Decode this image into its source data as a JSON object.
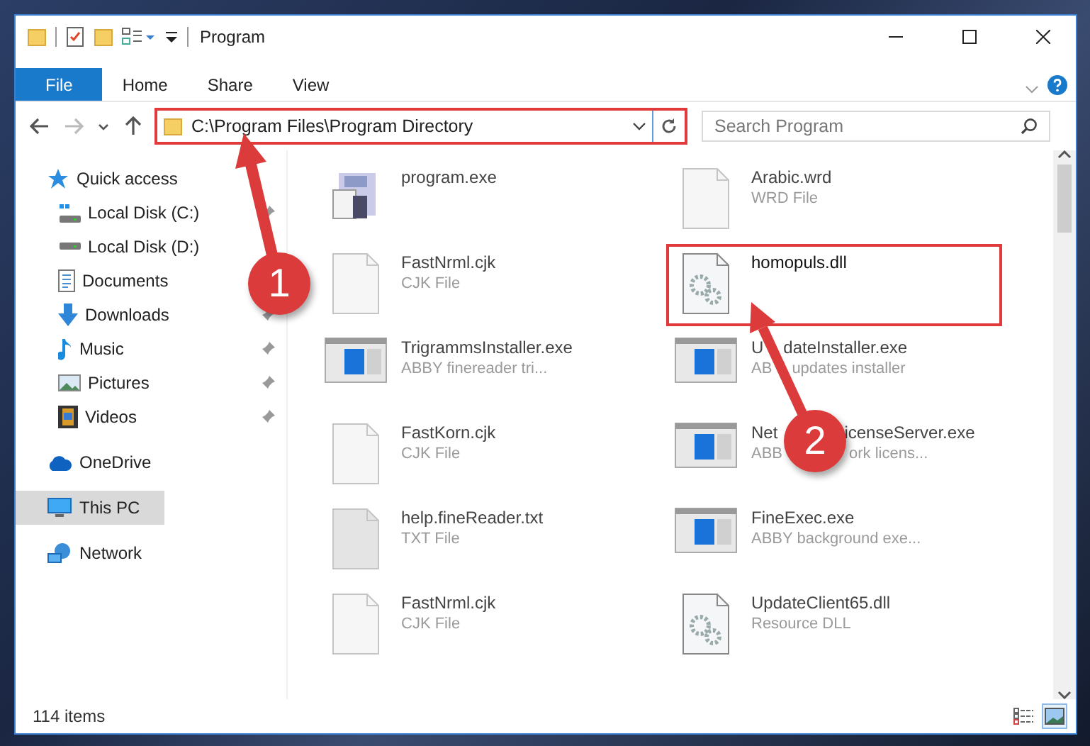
{
  "window": {
    "title": "Program"
  },
  "ribbon": {
    "tabs": [
      {
        "label": "File",
        "selected": true
      },
      {
        "label": "Home",
        "selected": false
      },
      {
        "label": "Share",
        "selected": false
      },
      {
        "label": "View",
        "selected": false
      }
    ]
  },
  "navigation": [
    {
      "kind": "back",
      "disabled": false
    },
    {
      "kind": "forward",
      "disabled": true
    },
    {
      "kind": "recent",
      "disabled": false
    },
    {
      "kind": "up",
      "disabled": false
    }
  ],
  "address_bar": {
    "path": "C:\\Program Files\\Program Directory",
    "highlighted": true
  },
  "search": {
    "placeholder": "Search Program"
  },
  "sidebar": {
    "items": [
      {
        "label": "Quick access",
        "kind": "star",
        "selected": false,
        "children": [
          {
            "label": "Local Disk (C:)",
            "kind": "system-drive",
            "pinned": true,
            "selected": false
          },
          {
            "label": "Local Disk (D:)",
            "kind": "drive",
            "pinned": false,
            "selected": false
          },
          {
            "label": "Documents",
            "kind": "document",
            "pinned": false,
            "selected": false
          },
          {
            "label": "Downloads",
            "kind": "download",
            "pinned": true,
            "selected": false
          },
          {
            "label": "Music",
            "kind": "music",
            "pinned": true,
            "selected": false
          },
          {
            "label": "Pictures",
            "kind": "pictures",
            "pinned": true,
            "selected": false
          },
          {
            "label": "Videos",
            "kind": "videos",
            "pinned": true,
            "selected": false
          }
        ]
      },
      {
        "label": "OneDrive",
        "kind": "cloud",
        "selected": false
      },
      {
        "label": "This PC",
        "kind": "computer",
        "selected": true
      },
      {
        "label": "Network",
        "kind": "network",
        "selected": false
      }
    ]
  },
  "files": [
    {
      "name": [
        "program.exe"
      ],
      "kind": "app",
      "highlighted": false
    },
    {
      "name": [
        "Arabic.wrd"
      ],
      "type": [
        "WRD File"
      ],
      "kind": "blank",
      "highlighted": false
    },
    {
      "name": [
        "FastNrml.cjk"
      ],
      "type": [
        "CJK File"
      ],
      "kind": "blank",
      "highlighted": false
    },
    {
      "name": [
        "homopuls.dll"
      ],
      "kind": "dll",
      "highlighted": true
    },
    {
      "name": [
        "TrigrammsInstaller.exe"
      ],
      "type": [
        "ABBY finereader tri..."
      ],
      "kind": "installer",
      "highlighted": false
    },
    {
      "name": [
        "U",
        "dateInstaller.exe"
      ],
      "type": [
        "AB",
        "updates installer"
      ],
      "kind": "installer",
      "highlighted": false
    },
    {
      "name": [
        "FastKorn.cjk"
      ],
      "type": [
        "CJK File"
      ],
      "kind": "blank",
      "highlighted": false
    },
    {
      "name": [
        "Net",
        "icenseServer.exe"
      ],
      "type": [
        "ABB",
        "ork licens..."
      ],
      "kind": "installer",
      "highlighted": false
    },
    {
      "name": [
        "help.fineReader.txt"
      ],
      "type": [
        "TXT File"
      ],
      "kind": "text",
      "highlighted": false
    },
    {
      "name": [
        "FineExec.exe"
      ],
      "type": [
        "ABBY background exe..."
      ],
      "kind": "installer",
      "highlighted": false
    },
    {
      "name": [
        "FastNrml.cjk"
      ],
      "type": [
        "CJK File"
      ],
      "kind": "blank",
      "highlighted": false
    },
    {
      "name": [
        "UpdateClient65.dll"
      ],
      "type": [
        "Resource DLL"
      ],
      "kind": "dll",
      "highlighted": false
    }
  ],
  "status_bar": {
    "count": "114 items",
    "views": [
      {
        "kind": "details",
        "selected": false
      },
      {
        "kind": "large-icons",
        "selected": true
      }
    ]
  },
  "callouts": [
    {
      "number": "1"
    },
    {
      "number": "2"
    }
  ]
}
